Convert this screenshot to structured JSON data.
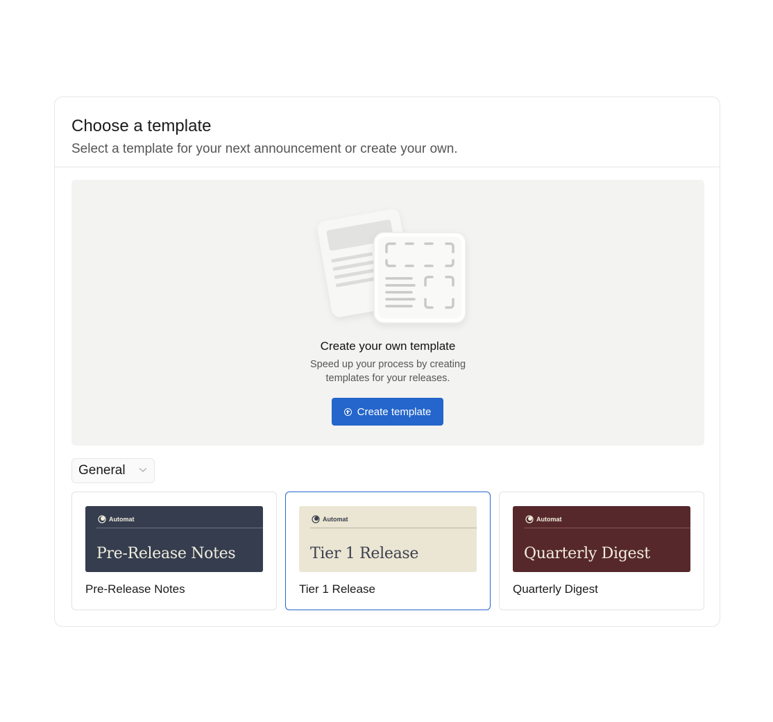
{
  "header": {
    "title": "Choose a template",
    "subtitle": "Select a template for your next announcement or create your own."
  },
  "create": {
    "title": "Create your own template",
    "description": "Speed up your process by creating templates for your releases.",
    "button_label": "Create template",
    "button_icon": "plus-circle-icon",
    "accent_color": "#2466cb"
  },
  "category": {
    "selected": "General"
  },
  "templates": [
    {
      "name": "Pre-Release Notes",
      "brand": "Automat",
      "thumb_title": "Pre-Release Notes",
      "bg": "#353d4f",
      "fg": "#f2eedd",
      "line": "#6b7385",
      "selected": false
    },
    {
      "name": "Tier 1 Release",
      "brand": "Automat",
      "thumb_title": "Tier 1 Release",
      "bg": "#ebe6d3",
      "fg": "#3b3f4e",
      "line": "#b9b4a2",
      "selected": true
    },
    {
      "name": "Quarterly Digest",
      "brand": "Automat",
      "thumb_title": "Quarterly Digest",
      "bg": "#56282b",
      "fg": "#f2eedd",
      "line": "#8a5457",
      "selected": false
    }
  ]
}
